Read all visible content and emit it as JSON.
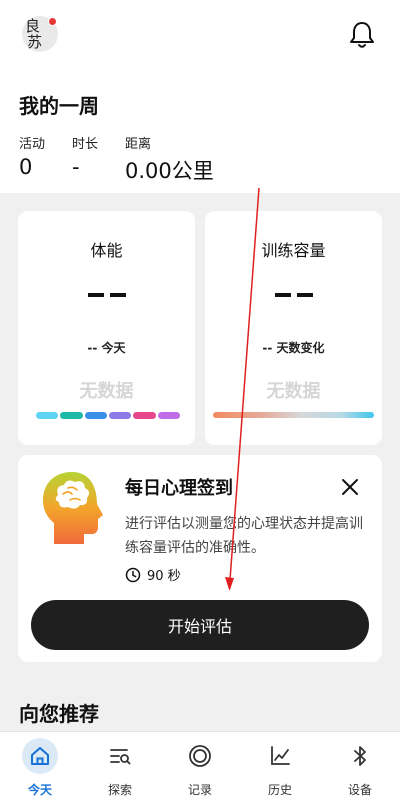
{
  "header": {
    "avatar_char_1": "良",
    "avatar_char_2": "苏",
    "notification_dot_color": "#e53935"
  },
  "week": {
    "title": "我的一周",
    "stats": [
      {
        "label": "活动",
        "value": "0"
      },
      {
        "label": "时长",
        "value": "-"
      },
      {
        "label": "距离",
        "value": "0.00公里"
      }
    ]
  },
  "fitness_card": {
    "title": "体能",
    "sub": "-- 今天",
    "no_data": "无数据",
    "bar_colors": [
      "#5fd3f3",
      "#1fb9a8",
      "#3a8fe8",
      "#8b7be8",
      "#e8488b",
      "#c06ce8"
    ]
  },
  "capacity_card": {
    "title": "训练容量",
    "sub": "-- 天数变化",
    "no_data": "无数据"
  },
  "checkin": {
    "title": "每日心理签到",
    "description": "进行评估以测量您的心理状态并提高训练容量评估的准确性。",
    "duration": "90 秒",
    "button_label": "开始评估"
  },
  "recommend": {
    "title": "向您推荐"
  },
  "tabs": [
    {
      "label": "今天",
      "icon": "home-icon",
      "active": true
    },
    {
      "label": "探索",
      "icon": "explore-icon",
      "active": false
    },
    {
      "label": "记录",
      "icon": "record-icon",
      "active": false
    },
    {
      "label": "历史",
      "icon": "history-chart-icon",
      "active": false
    },
    {
      "label": "设备",
      "icon": "bluetooth-icon",
      "active": false
    }
  ],
  "colors": {
    "accent": "#1672d6",
    "arrow": "#e02020"
  }
}
